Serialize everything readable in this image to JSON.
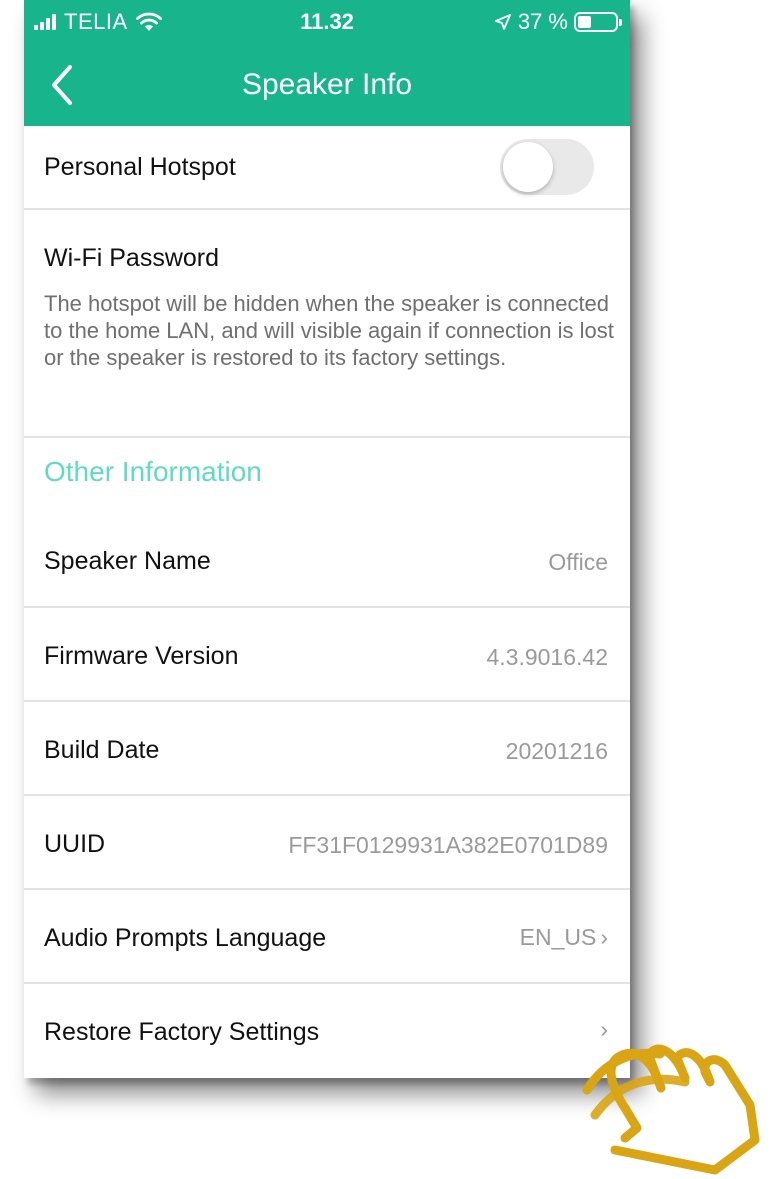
{
  "status_bar": {
    "carrier": "TELIA",
    "time": "11.32",
    "battery": "37 %",
    "battery_level": 0.37
  },
  "nav": {
    "title": "Speaker Info",
    "back_icon": "chevron-left-icon"
  },
  "hotspot": {
    "label": "Personal Hotspot",
    "enabled": false
  },
  "wifi_password": {
    "label": "Wi-Fi Password",
    "description": "The hotspot will be hidden when the speaker is connected to the home LAN, and will visible again if connection is lost or the speaker is restored to its factory settings."
  },
  "other_info": {
    "header": "Other Information",
    "rows": [
      {
        "label": "Speaker Name",
        "value": "Office"
      },
      {
        "label": "Firmware Version",
        "value": "4.3.9016.42"
      },
      {
        "label": "Build Date",
        "value": "20201216"
      },
      {
        "label": "UUID",
        "value": "FF31F0129931A382E0701D89"
      },
      {
        "label": "Audio Prompts Language",
        "value": "EN_US"
      },
      {
        "label": "Restore Factory Settings",
        "value": ""
      }
    ]
  },
  "colors": {
    "accent": "#18b48b",
    "section_header": "#5fdcc0",
    "hand": "#d9a514"
  },
  "icons": [
    "signal-icon",
    "wifi-icon",
    "location-icon",
    "battery-icon",
    "chevron-left-icon",
    "chevron-right-icon",
    "pointing-hand-icon"
  ]
}
